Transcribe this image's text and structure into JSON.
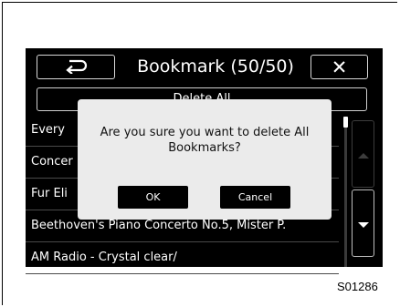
{
  "header": {
    "title": "Bookmark (50/50)",
    "back_icon": "return-arrow-icon",
    "close_icon": "close-icon",
    "close_glyph": "✕"
  },
  "delete_all_label": "Delete All",
  "bookmarks": [
    {
      "label": "Every"
    },
    {
      "label": "Concer"
    },
    {
      "label": "Fur Eli"
    },
    {
      "label": "Beethoven's Piano Concerto No.5, Mister P."
    },
    {
      "label": "AM Radio - Crystal clear/"
    }
  ],
  "dialog": {
    "message": "Are you sure you want to delete All Bookmarks?",
    "ok_label": "OK",
    "cancel_label": "Cancel"
  },
  "figure_code": "S01286",
  "colors": {
    "screen_background": "#000000",
    "dialog_background": "#ebebeb",
    "text_on_screen": "#ffffff"
  }
}
